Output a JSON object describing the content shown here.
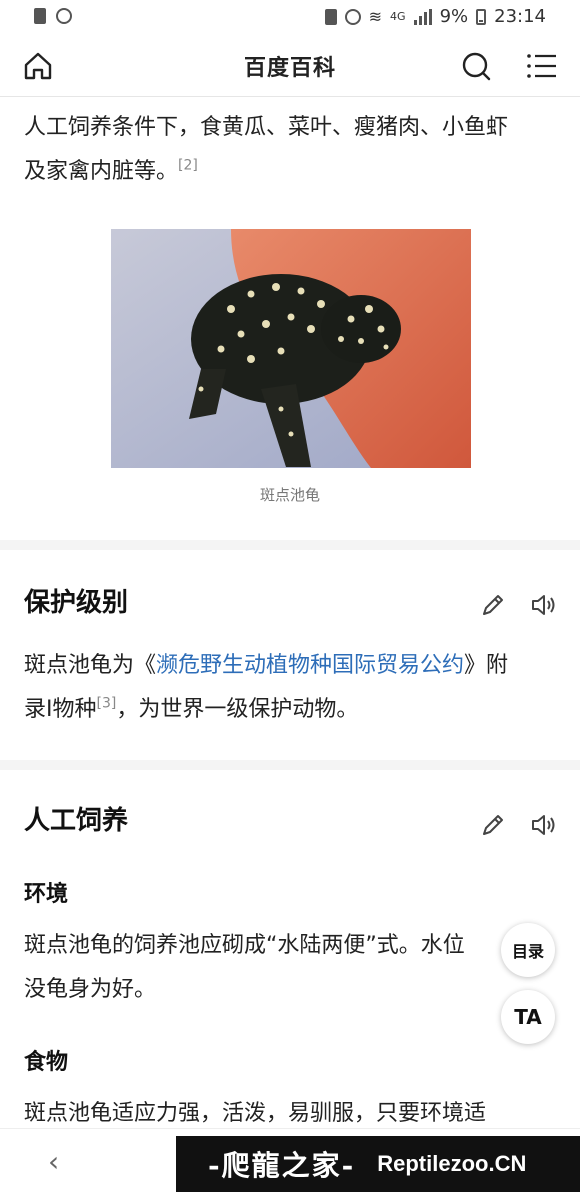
{
  "status_bar": {
    "network": "4G",
    "battery": "9%",
    "time": "23:14"
  },
  "header": {
    "title": "百度百科"
  },
  "intro": {
    "text_line1": "人工饲养条件下，食黄瓜、菜叶、瘦猪肉、小鱼虾",
    "text_line2": "及家禽内脏等。",
    "ref": "[2]"
  },
  "figure": {
    "caption": "斑点池龟"
  },
  "protection": {
    "title": "保护级别",
    "text_before": "斑点池龟为《",
    "link": "濒危野生动植物种国际贸易公约",
    "text_after": "》附",
    "line2_before": "录I物种",
    "ref": "[3]",
    "line2_after": "，为世界一级保护动物。"
  },
  "breeding": {
    "title": "人工饲养",
    "env_title": "环境",
    "env_line1": "斑点池龟的饲养池应砌成“水陆两便”式。水位",
    "env_line2": "没龟身为好。",
    "food_title": "食物",
    "food_line1": "斑点池龟适应力强，活泼，易驯服，只要环境适"
  },
  "floating": {
    "toc_label": "目录",
    "ta_label": "TA"
  },
  "watermark": {
    "cn": "-爬龍之家-",
    "en": "Reptilezoo.CN"
  },
  "colors": {
    "link": "#2d6db8",
    "section_gap": "#f4f4f4"
  }
}
